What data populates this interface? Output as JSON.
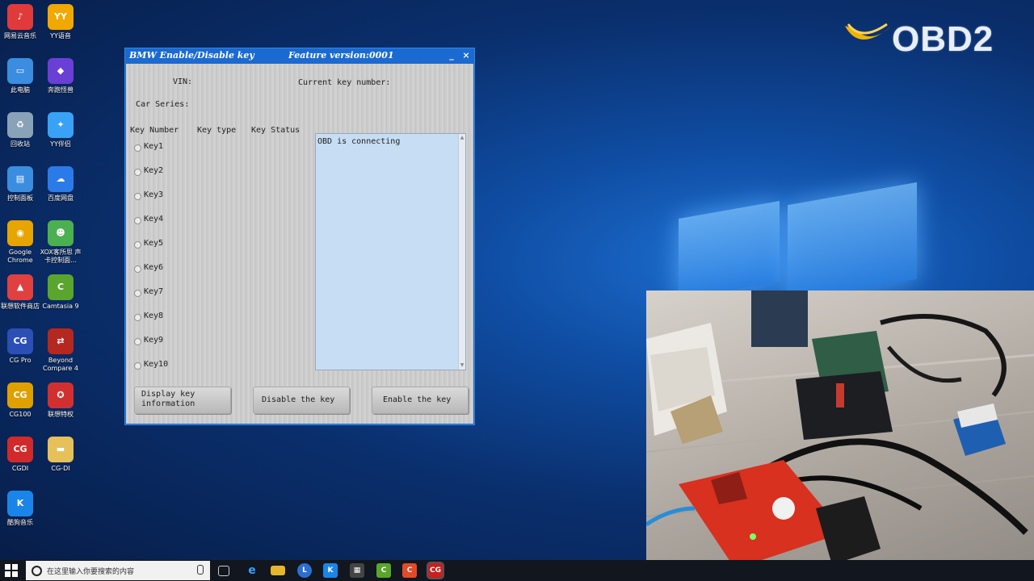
{
  "desktop": {
    "icons": [
      {
        "label": "网易云音乐",
        "glyph": "♪",
        "color": "#e03a3a"
      },
      {
        "label": "YY语音",
        "glyph": "YY",
        "color": "#f1a800"
      },
      {
        "label": "此电脑",
        "glyph": "▭",
        "color": "#3b8de0"
      },
      {
        "label": "奔跑怪兽",
        "glyph": "◆",
        "color": "#6a3fd6"
      },
      {
        "label": "回收站",
        "glyph": "♻",
        "color": "#8aa2b8"
      },
      {
        "label": "YY伴侣",
        "glyph": "✦",
        "color": "#3aa2f5"
      },
      {
        "label": "控制面板",
        "glyph": "▤",
        "color": "#3b8de0"
      },
      {
        "label": "百度网盘",
        "glyph": "☁",
        "color": "#2a7be8"
      },
      {
        "label": "Google Chrome",
        "glyph": "◉",
        "color": "#e8a400"
      },
      {
        "label": "XOX客所思 声卡控制面...",
        "glyph": "☻",
        "color": "#4caf50"
      },
      {
        "label": "联想软件商店",
        "glyph": "▲",
        "color": "#e04040"
      },
      {
        "label": "Camtasia 9",
        "glyph": "C",
        "color": "#5aa52c"
      },
      {
        "label": "CG Pro",
        "glyph": "CG",
        "color": "#2c4fb5"
      },
      {
        "label": "Beyond Compare 4",
        "glyph": "⇄",
        "color": "#b5281f"
      },
      {
        "label": "CG100",
        "glyph": "CG",
        "color": "#e0a000"
      },
      {
        "label": "联想特权",
        "glyph": "✪",
        "color": "#d23030"
      },
      {
        "label": "CGDI",
        "glyph": "CG",
        "color": "#d22a2a"
      },
      {
        "label": "CG-DI",
        "glyph": "▬",
        "color": "#e6c15a"
      },
      {
        "label": "酷狗音乐",
        "glyph": "K",
        "color": "#1a85e8"
      }
    ]
  },
  "brand": {
    "logo_text": "OBD2",
    "swoosh_color": "#f2b400"
  },
  "app": {
    "title": "BMW Enable/Disable key",
    "feature": "Feature version:0001",
    "minimize": "_",
    "close": "×",
    "vin_label": "VIN:",
    "current_key_label": "Current key number:",
    "car_series_label": "Car Series:",
    "col_headers": [
      "Key Number",
      "Key type",
      "Key Status"
    ],
    "keys": [
      "Key1",
      "Key2",
      "Key3",
      "Key4",
      "Key5",
      "Key6",
      "Key7",
      "Key8",
      "Key9",
      "Key10"
    ],
    "log_text": "OBD is connecting",
    "buttons": {
      "display_line1": "Display key",
      "display_line2": "information",
      "disable": "Disable the key",
      "enable": "Enable the key"
    }
  },
  "taskbar": {
    "search_placeholder": "在这里输入你要搜索的内容",
    "apps": [
      "task-view",
      "edge",
      "file-explorer",
      "lenovo",
      "kugou",
      "calculator",
      "camtasia",
      "cgdi",
      "cg-red"
    ]
  },
  "colors": {
    "titlebar": "#1a6ad1",
    "log_bg": "#c7ddf3",
    "desktop": "#0f4da3"
  }
}
